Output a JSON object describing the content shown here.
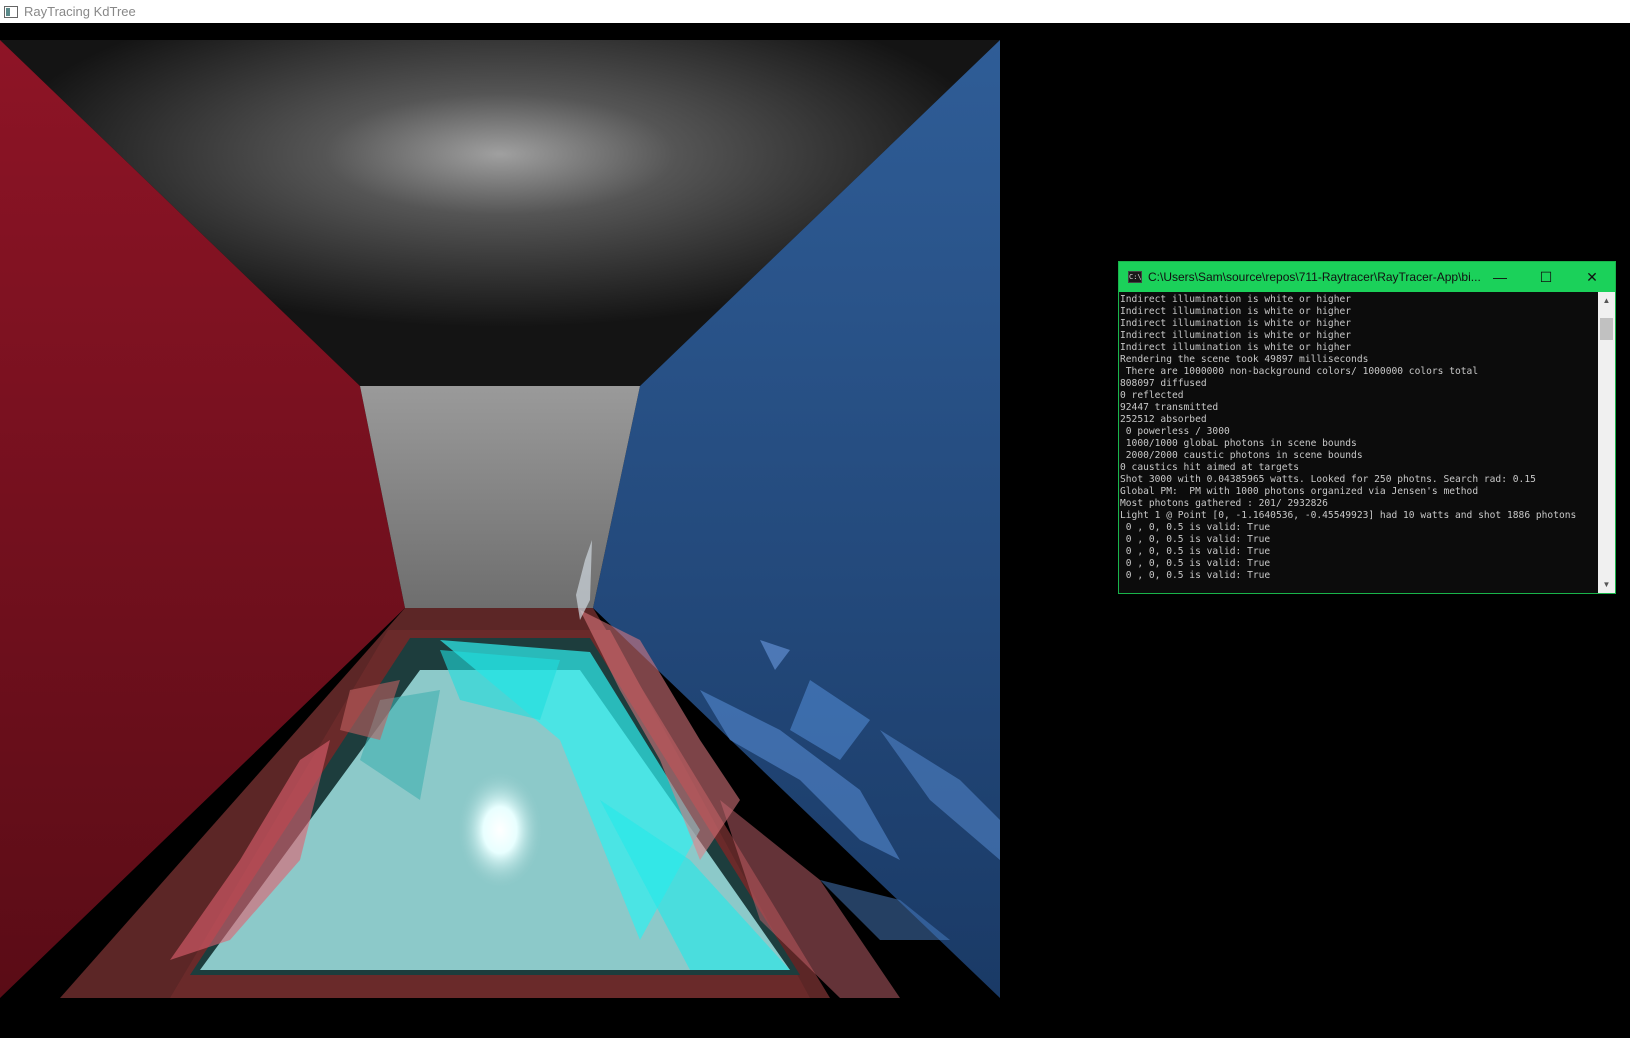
{
  "window": {
    "title": "RayTracing KdTree",
    "icon": "app-window-icon"
  },
  "render": {
    "description_colors": {
      "left_wall": "#8f1224",
      "right_wall": "#2d5a94",
      "ceiling": "#1c1c1c",
      "back_wall": "#8c8c8c",
      "floor": "#5a2424",
      "water": "#4fe6e6"
    }
  },
  "console": {
    "title": "C:\\Users\\Sam\\source\\repos\\711-Raytracer\\RayTracer-App\\bi...",
    "icon": "cmd-icon",
    "minimize_label": "—",
    "maximize_label": "☐",
    "close_label": "✕",
    "lines": [
      "Indirect illumination is white or higher",
      "Indirect illumination is white or higher",
      "Indirect illumination is white or higher",
      "Indirect illumination is white or higher",
      "Indirect illumination is white or higher",
      "Rendering the scene took 49897 milliseconds",
      " There are 1000000 non-background colors/ 1000000 colors total",
      "808097 diffused",
      "0 reflected",
      "92447 transmitted",
      "252512 absorbed",
      " 0 powerless / 3000",
      " 1000/1000 globaL photons in scene bounds",
      " 2000/2000 caustic photons in scene bounds",
      "0 caustics hit aimed at targets",
      "Shot 3000 with 0.04385965 watts. Looked for 250 photns. Search rad: 0.15",
      "Global PM:  PM with 1000 photons organized via Jensen's method",
      "Most photons gathered : 201/ 2932826",
      "Light 1 @ Point [0, -1.1640536, -0.45549923] had 10 watts and shot 1886 photons",
      " 0 , 0, 0.5 is valid: True",
      " 0 , 0, 0.5 is valid: True",
      " 0 , 0, 0.5 is valid: True",
      " 0 , 0, 0.5 is valid: True",
      " 0 , 0, 0.5 is valid: True"
    ]
  }
}
